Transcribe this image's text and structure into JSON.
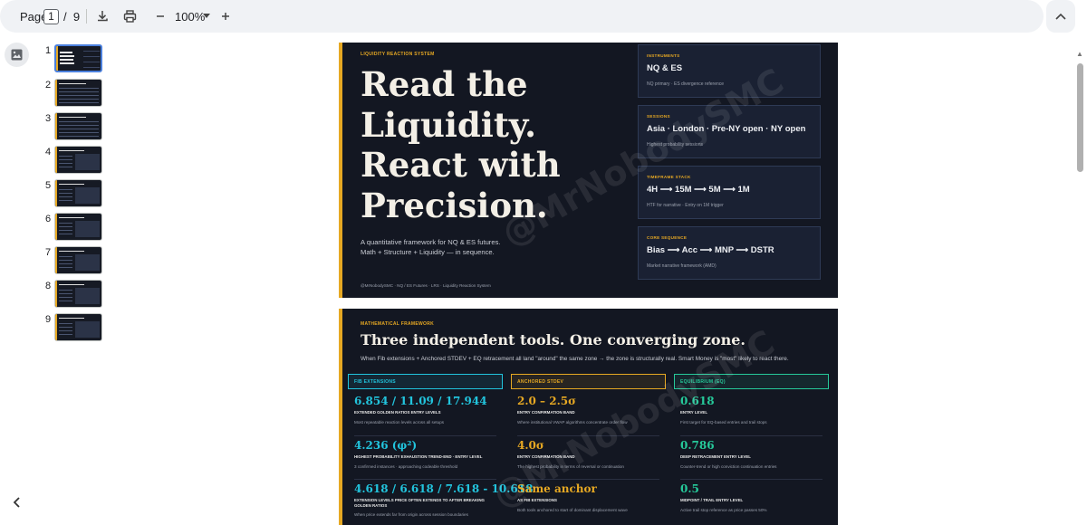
{
  "toolbar": {
    "page_label": "Page",
    "current_page": "1",
    "separator": "/",
    "total_pages": "9",
    "zoom": "100%",
    "icons": [
      "download-icon",
      "print-icon",
      "zoom-out-icon",
      "zoom-dropdown-icon",
      "zoom-in-icon",
      "collapse-icon"
    ]
  },
  "sidebar": {
    "thumbnails": [
      {
        "num": "1"
      },
      {
        "num": "2"
      },
      {
        "num": "3"
      },
      {
        "num": "4"
      },
      {
        "num": "5"
      },
      {
        "num": "6"
      },
      {
        "num": "7"
      },
      {
        "num": "8"
      },
      {
        "num": "9"
      }
    ]
  },
  "slide1": {
    "kicker": "LIQUIDITY REACTION SYSTEM",
    "hero_lines": [
      "Read the",
      "Liquidity.",
      "React with",
      "Precision."
    ],
    "subtitle_lines": [
      "A quantitative framework for NQ & ES futures.",
      "Math + Structure + Liquidity — in sequence."
    ],
    "footer": "@MrNobodySMC  ·  NQ / ES Futures  ·  LRS · Liquidity Reaction System",
    "watermark": "@MrNobodySMC",
    "cards": [
      {
        "label": "INSTRUMENTS",
        "value": "NQ  &  ES",
        "note": "NQ primary · ES divergence reference"
      },
      {
        "label": "SESSIONS",
        "value": "Asia · London · Pre-NY open · NY open",
        "note": "Highest probability sessions"
      },
      {
        "label": "TIMEFRAME STACK",
        "value": "4H ⟶ 15M ⟶ 5M ⟶ 1M",
        "note": "HTF for narrative · Entry on 1M trigger"
      },
      {
        "label": "CORE SEQUENCE",
        "value": "Bias ⟶ Acc ⟶ MNP ⟶ DSTR",
        "note": "Market narrative framework (AMD)"
      }
    ]
  },
  "slide2": {
    "kicker": "MATHEMATICAL FRAMEWORK",
    "title": "Three independent tools. One converging zone.",
    "subtitle": "When Fib extensions + Anchored STDEV + EQ retracement all land \"around\" the same zone → the zone is structurally real. Smart Money is \"most\" likely to react there.",
    "watermark": "@MrNobodySMC",
    "columns": [
      {
        "head": "FIB EXTENSIONS",
        "metrics": [
          {
            "value": "6.854 / 11.09 / 17.944",
            "title": "EXTENDED GOLDEN RATIOS ENTRY LEVELS",
            "note": "Most repeatable reaction levels across all setups"
          },
          {
            "value": "4.236  (φ²)",
            "title": "HIGHEST PROBABILITY EXHAUSTION TREND-END · ENTRY LEVEL",
            "note": "3 confirmed instances · approaching codeable threshold"
          },
          {
            "value": "4.618 / 6.618 / 7.618 - 10.618",
            "title": "EXTENSION LEVELS PRICE OFTEN EXTENDS TO AFTER BREAKING GOLDEN RATIOS",
            "note": "When price extends far from origin across session boundaries"
          }
        ]
      },
      {
        "head": "ANCHORED STDEV",
        "metrics": [
          {
            "value": "2.0 – 2.5σ",
            "title": "ENTRY CONFIRMATION BAND",
            "note": "Where institutional VWAP algorithms concentrate order flow"
          },
          {
            "value": "4.0σ",
            "title": "ENTRY CONFIRMATION BAND",
            "note": "The highest probability in terms of reversal or continuation"
          },
          {
            "value": "Same anchor",
            "title": "AS FIB EXTENSIONS",
            "note": "Both tools anchored to start of dominant displacement wave"
          }
        ]
      },
      {
        "head": "EQUILIBRIUM (EQ)",
        "metrics": [
          {
            "value": "0.618",
            "title": "ENTRY LEVEL",
            "note": "First target for EQ-based entries and trail stops"
          },
          {
            "value": "0.786",
            "title": "DEEP RETRACEMENT ENTRY LEVEL",
            "note": "Counter-trend or high conviction continuation entries"
          },
          {
            "value": "0.5",
            "title": "MIDPOINT / TRAIL ENTRY LEVEL",
            "note": "Active trail stop reference as price passes 50%"
          }
        ]
      }
    ]
  },
  "colors": {
    "accent": "#e6a823",
    "slide_bg": "#131722",
    "fib": "#22c4dd",
    "stdev": "#e6a823",
    "eq": "#26c99a"
  }
}
